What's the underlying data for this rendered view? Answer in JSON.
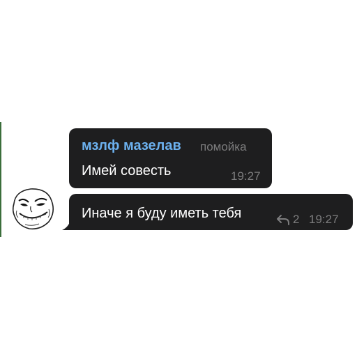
{
  "messages": [
    {
      "sender": "мзлф мазелав",
      "sender_title": "помойка",
      "text": "Имей совесть",
      "time": "19:27"
    },
    {
      "text": "Иначе я буду иметь тебя",
      "replies": "2",
      "time": "19:27"
    }
  ],
  "colors": {
    "bubble": "#1e1e1f",
    "sender_name": "#6cb1ef",
    "meta_text": "#7d7d7e",
    "message_text": "#ffffff"
  },
  "icons": {
    "avatar": "trollface-sticker",
    "replies": "reply-arrow-icon"
  }
}
